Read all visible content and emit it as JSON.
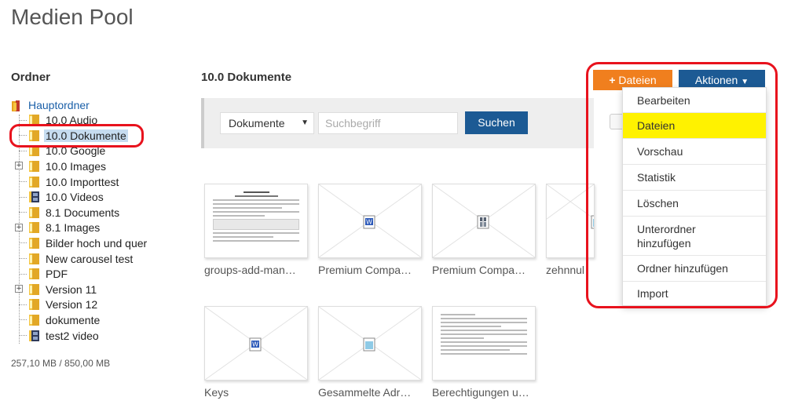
{
  "page": {
    "title": "Medien Pool"
  },
  "sidebar": {
    "heading": "Ordner",
    "tree": [
      {
        "label": "Hauptordner",
        "icon": "root-folder-icon",
        "level": 0
      },
      {
        "label": "10.0 Audio",
        "icon": "folder-icon",
        "level": 1
      },
      {
        "label": "10.0 Dokumente",
        "icon": "folder-icon",
        "level": 1,
        "selected": true
      },
      {
        "label": "10.0 Google",
        "icon": "folder-icon",
        "level": 1
      },
      {
        "label": "10.0 Images",
        "icon": "folder-icon",
        "level": 1,
        "expandable": true
      },
      {
        "label": "10.0 Importtest",
        "icon": "folder-icon",
        "level": 1
      },
      {
        "label": "10.0 Videos",
        "icon": "video-folder-icon",
        "level": 1
      },
      {
        "label": "8.1 Documents",
        "icon": "folder-icon",
        "level": 1
      },
      {
        "label": "8.1 Images",
        "icon": "folder-icon",
        "level": 1,
        "expandable": true
      },
      {
        "label": "Bilder hoch und quer",
        "icon": "folder-icon",
        "level": 1
      },
      {
        "label": "New carousel test",
        "icon": "folder-icon",
        "level": 1
      },
      {
        "label": "PDF",
        "icon": "folder-icon",
        "level": 1
      },
      {
        "label": "Version 11",
        "icon": "folder-icon",
        "level": 1,
        "expandable": true
      },
      {
        "label": "Version 12",
        "icon": "folder-icon",
        "level": 1
      },
      {
        "label": "dokumente",
        "icon": "folder-icon",
        "level": 1
      },
      {
        "label": "test2 video",
        "icon": "video-folder-icon",
        "level": 1
      }
    ],
    "usage": "257,10 MB / 850,00 MB"
  },
  "main": {
    "heading": "10.0 Dokumente",
    "search": {
      "type_value": "Dokumente",
      "placeholder": "Suchbegriff",
      "button_label": "Suchen"
    },
    "files": [
      {
        "label": "groups-add-man…",
        "thumb": "document-preview",
        "icon": ""
      },
      {
        "label": "Premium Compa…",
        "thumb": "placeholder",
        "icon": "word-doc-icon"
      },
      {
        "label": "Premium Compa…",
        "thumb": "placeholder",
        "icon": "archive-file-icon"
      },
      {
        "label": "zehnnul",
        "thumb": "placeholder",
        "icon": "generic-file-icon"
      },
      {
        "label": "Keys",
        "thumb": "placeholder",
        "icon": "word-doc-icon"
      },
      {
        "label": "Gesammelte Adr…",
        "thumb": "placeholder",
        "icon": "generic-file-icon"
      },
      {
        "label": "Berechtigungen u…",
        "thumb": "text-preview",
        "icon": ""
      }
    ]
  },
  "toolbar": {
    "upload_label": "Dateien",
    "upload_icon": "plus-icon",
    "actions_label": "Aktionen",
    "actions_icon": "chevron-down-icon",
    "upload_color": "#f07f1e",
    "actions_color": "#1c5a94"
  },
  "actions_menu": {
    "items": [
      {
        "label": "Bearbeiten"
      },
      {
        "label": "Dateien",
        "highlighted": true
      },
      {
        "label": "Vorschau"
      },
      {
        "label": "Statistik"
      },
      {
        "label": "Löschen"
      },
      {
        "label": "Unterordner hinzufügen"
      },
      {
        "label": "Ordner hinzufügen"
      },
      {
        "label": "Import"
      }
    ],
    "highlight_color": "#fff200"
  },
  "annotations": {
    "color": "#e8121d"
  }
}
